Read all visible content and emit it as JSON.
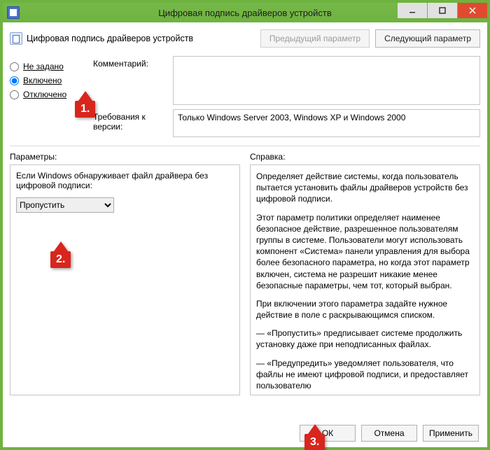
{
  "window": {
    "title": "Цифровая подпись драйверов устройств"
  },
  "header": {
    "subtitle": "Цифровая подпись драйверов устройств",
    "prev_btn": "Предыдущий параметр",
    "next_btn": "Следующий параметр"
  },
  "state": {
    "radio": {
      "not_configured": "Не задано",
      "enabled": "Включено",
      "disabled": "Отключено"
    },
    "comment_label": "Комментарий:",
    "comment_value": "",
    "req_label": "Требования к версии:",
    "req_value": "Только Windows Server 2003, Windows XP и Windows 2000"
  },
  "params": {
    "label": "Параметры:",
    "prompt": "Если Windows обнаруживает файл драйвера без цифровой подписи:",
    "action_selected": "Пропустить"
  },
  "help": {
    "label": "Справка:",
    "p1": "Определяет действие системы, когда пользователь пытается установить файлы драйверов устройств без цифровой подписи.",
    "p2": "Этот параметр политики определяет наименее безопасное действие, разрешенное пользователям группы в системе. Пользователи могут использовать компонент «Система» панели управления для выбора более безопасного параметра, но когда этот параметр включен, система не разрешит никакие менее безопасные параметры, чем тот, который выбран.",
    "p3": "При включении этого параметра задайте нужное действие в поле с раскрывающимся списком.",
    "p4": "— «Пропустить» предписывает системе продолжить установку даже при неподписанных файлах.",
    "p5": "— «Предупредить» уведомляет пользователя, что файлы не имеют цифровой подписи, и предоставляет пользователю"
  },
  "buttons": {
    "ok": "ОК",
    "cancel": "Отмена",
    "apply": "Применить"
  },
  "callouts": {
    "c1": "1.",
    "c2": "2.",
    "c3": "3."
  }
}
